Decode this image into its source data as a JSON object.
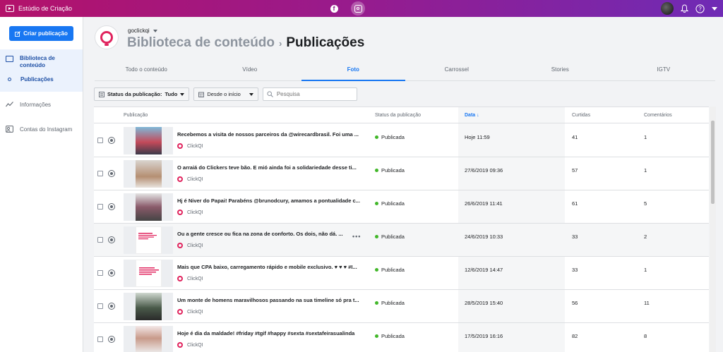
{
  "topbar": {
    "app_title": "Estúdio de Criação",
    "platform_icons": [
      "facebook-icon",
      "instagram-icon"
    ],
    "active_platform": "instagram-icon",
    "gradient_colors": [
      "#b3126a",
      "#6f2bb5"
    ]
  },
  "sidebar": {
    "create_button": "Criar publicação",
    "library_label": "Biblioteca de conteúdo",
    "library_sub_item": "Publicações",
    "items": [
      {
        "label": "Informações",
        "icon": "insights-icon"
      },
      {
        "label": "Contas do Instagram",
        "icon": "instagram-accounts-icon"
      }
    ],
    "accent_color": "#1877f2"
  },
  "header": {
    "account_name": "goclickqi",
    "breadcrumb_root": "Biblioteca de conteúdo",
    "breadcrumb_separator": "›",
    "page_title": "Publicações"
  },
  "tabs": [
    {
      "label": "Todo o conteúdo",
      "active": false
    },
    {
      "label": "Vídeo",
      "active": false
    },
    {
      "label": "Foto",
      "active": true
    },
    {
      "label": "Carrossel",
      "active": false
    },
    {
      "label": "Stories",
      "active": false
    },
    {
      "label": "IGTV",
      "active": false
    }
  ],
  "filters": {
    "status_label": "Status da publicação:",
    "status_value": "Tudo",
    "date_label": "Desde o início",
    "search_placeholder": "Pesquisa"
  },
  "table": {
    "columns": [
      "Publicação",
      "Status da publicação",
      "Data",
      "Curtidas",
      "Comentários"
    ],
    "sorted_column": "Data",
    "sort_arrow": "↓",
    "rows": [
      {
        "text": "Recebemos a visita de nossos parceiros da @wirecardbrasil. Foi uma ...",
        "account": "ClickQI",
        "status": "Publicada",
        "date": "Hoje 11:59",
        "likes": "41",
        "comments": "1"
      },
      {
        "text": "O arraiá do Clickers teve bão. E mió ainda foi a solidariedade desse ti...",
        "account": "ClickQI",
        "status": "Publicada",
        "date": "27/6/2019 09:36",
        "likes": "57",
        "comments": "1"
      },
      {
        "text": "Hj é Niver do Papai! Parabéns @brunodcury, amamos a pontualidade c...",
        "account": "ClickQI",
        "status": "Publicada",
        "date": "26/6/2019 11:41",
        "likes": "61",
        "comments": "5"
      },
      {
        "text": "Ou a gente cresce ou fica na zona de conforto. Os dois, não dá. ...",
        "account": "ClickQI",
        "status": "Publicada",
        "date": "24/6/2019 10:33",
        "likes": "33",
        "comments": "2"
      },
      {
        "text": "Mais que CPA baixo, carregamento rápido e mobile exclusivo. ♥ ♥ ♥ #I...",
        "account": "ClickQI",
        "status": "Publicada",
        "date": "12/6/2019 14:47",
        "likes": "33",
        "comments": "1"
      },
      {
        "text": "Um monte de homens maravilhosos passando na sua timeline só pra t...",
        "account": "ClickQI",
        "status": "Publicada",
        "date": "28/5/2019 15:40",
        "likes": "56",
        "comments": "11"
      },
      {
        "text": "Hoje é dia da maldade! #friday #tgif #happy #sexta #sextafeirasualinda",
        "account": "ClickQI",
        "status": "Publicada",
        "date": "17/5/2019 16:16",
        "likes": "82",
        "comments": "8"
      }
    ],
    "status_color": "#42b72a",
    "brand_pink": "#e0245e"
  }
}
